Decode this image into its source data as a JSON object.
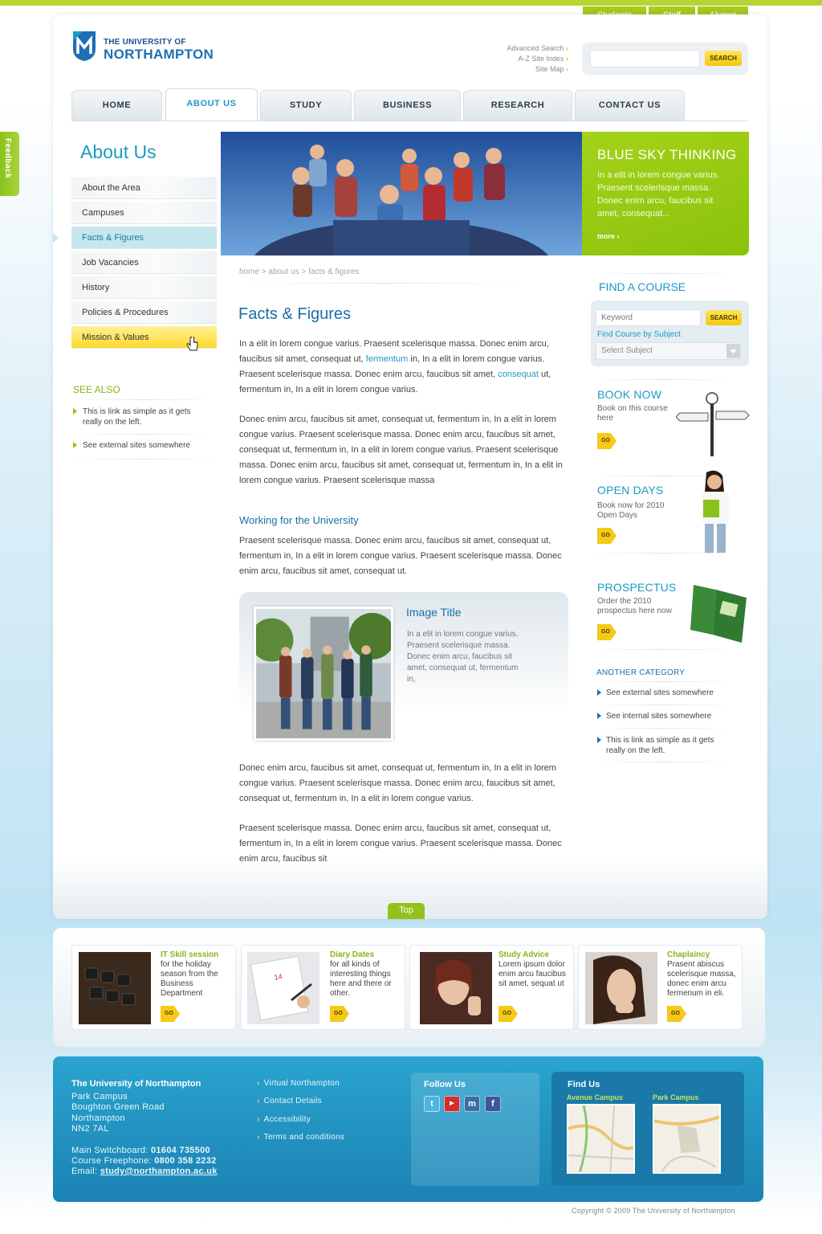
{
  "util_tabs": [
    "Students",
    "Staff",
    "Alumni"
  ],
  "logo": {
    "line1": "THE UNIVERSITY OF",
    "line2": "NORTHAMPTON"
  },
  "top_links": [
    "Advanced Search",
    "A-Z Site Index",
    "Site Map"
  ],
  "search": {
    "placeholder": "",
    "button": "SEARCH"
  },
  "nav": [
    "HOME",
    "ABOUT US",
    "STUDY",
    "BUSINESS",
    "RESEARCH",
    "CONTACT US"
  ],
  "nav_active": "ABOUT US",
  "feedback": "Feedback",
  "sidebar": {
    "title": "About Us",
    "items": [
      "About the Area",
      "Campuses",
      "Facts & Figures",
      "Job Vacancies",
      "History",
      "Policies & Procedures",
      "Mission & Values"
    ],
    "selected": "Facts & Figures",
    "hovered": "Mission & Values",
    "see_also_title": "SEE ALSO",
    "see_also": [
      "This is link as simple as it gets really on the left.",
      "See external sites somewhere"
    ]
  },
  "hero_promo": {
    "title": "BLUE SKY THINKING",
    "text": "In a elit in lorem congue varius. Praesent scelerisque massa. Donec enim arcu, faucibus sit amet, consequat...",
    "more": "more"
  },
  "breadcrumb": "home > about us > facts & figures",
  "content": {
    "title": "Facts & Figures",
    "p1a": "In a elit in lorem congue varius. Praesent scelerisque massa. Donec enim arcu, faucibus sit amet, consequat ut, ",
    "p1link1": "fermentum",
    "p1b": " in, In a elit in lorem congue varius. Praesent scelerisque massa. Donec enim arcu, faucibus sit amet, ",
    "p1link2": "consequat",
    "p1c": " ut, fermentum in, In a elit in lorem congue varius.",
    "p2": "Donec enim arcu, faucibus sit amet, consequat ut, fermentum in, In a elit in lorem congue varius. Praesent scelerisque massa. Donec enim arcu, faucibus sit amet, consequat ut, fermentum in, In a elit in lorem congue varius. Praesent scelerisque massa. Donec enim arcu, faucibus sit amet, consequat ut, fermentum in, In a elit in lorem congue varius. Praesent scelerisque massa",
    "subtitle": "Working for the University",
    "p3": "Praesent scelerisque massa. Donec enim arcu, faucibus sit amet, consequat ut, fermentum in, In a elit in lorem congue varius. Praesent scelerisque massa. Donec enim arcu, faucibus sit amet, consequat ut.",
    "image_title": "Image Title",
    "image_text": "In a elit in lorem congue varius. Praesent scelerisque massa. Donec enim arcu, faucibus sit amet, consequat ut, fermentum in,",
    "p4": "Donec enim arcu, faucibus sit amet, consequat ut, fermentum in, In a elit in lorem congue varius. Praesent scelerisque massa. Donec enim arcu, faucibus sit amet, consequat ut, fermentum in, In a elit in lorem congue varius.",
    "p5": "Praesent scelerisque massa. Donec enim arcu, faucibus sit amet, consequat ut, fermentum in, In a elit in lorem congue varius. Praesent scelerisque massa. Donec enim arcu, faucibus sit",
    "top": "Top"
  },
  "find_course": {
    "title": "FIND A COURSE",
    "keyword_placeholder": "Keyword",
    "button": "SEARCH",
    "subject_link": "Find Course by Subject",
    "select": "Select Subject"
  },
  "promos": [
    {
      "title": "BOOK NOW",
      "text": "Book on this course here",
      "go": "GO"
    },
    {
      "title": "OPEN DAYS",
      "text": "Book now for 2010 Open Days",
      "go": "GO"
    },
    {
      "title": "PROSPECTUS",
      "text": "Order the 2010 prospectus here now",
      "go": "GO"
    }
  ],
  "another_category": {
    "title": "ANOTHER CATEGORY",
    "links": [
      "See external sites somewhere",
      "See internal sites somewhere",
      "This is link as simple as it gets really on the left."
    ]
  },
  "cards": [
    {
      "title": "IT Skill session",
      "text": "for the holiday season from the Business Department",
      "go": "GO"
    },
    {
      "title": "Diary Dates",
      "text": "for all kinds of interesting things here and there or other.",
      "go": "GO"
    },
    {
      "title": "Study Advice",
      "text": "Lorem ipsum dolor enim arcu faucibus sit amet, sequat ut",
      "go": "GO"
    },
    {
      "title": "Chaplaincy",
      "text": "Prasent abiscus scelerisque massa, donec enim arcu fermenum in eli.",
      "go": "GO"
    }
  ],
  "footer": {
    "name": "The University of Northampton",
    "address": [
      "Park Campus",
      "Boughton Green Road",
      "Northampton",
      "NN2 7AL"
    ],
    "switchboard_label": "Main Switchboard: ",
    "switchboard": "01604 735500",
    "freephone_label": "Course Freephone: ",
    "freephone": "0800 358 2232",
    "email_label": "Email: ",
    "email": "study@northampton.ac.uk",
    "links": [
      "Virtual Northampton",
      "Contact Details",
      "Accessibility",
      "Terms and conditions"
    ],
    "follow_title": "Follow Us",
    "find_title": "Find Us",
    "campuses": [
      "Avenue Campus",
      "Park Campus"
    ]
  },
  "copyright": "Copyright © 2009 The University of Northampton",
  "colors": {
    "brand_green": "#8cc21b",
    "brand_blue": "#1b9ac4",
    "accent_yellow": "#f5c916",
    "footer_blue": "#1b82b4"
  }
}
